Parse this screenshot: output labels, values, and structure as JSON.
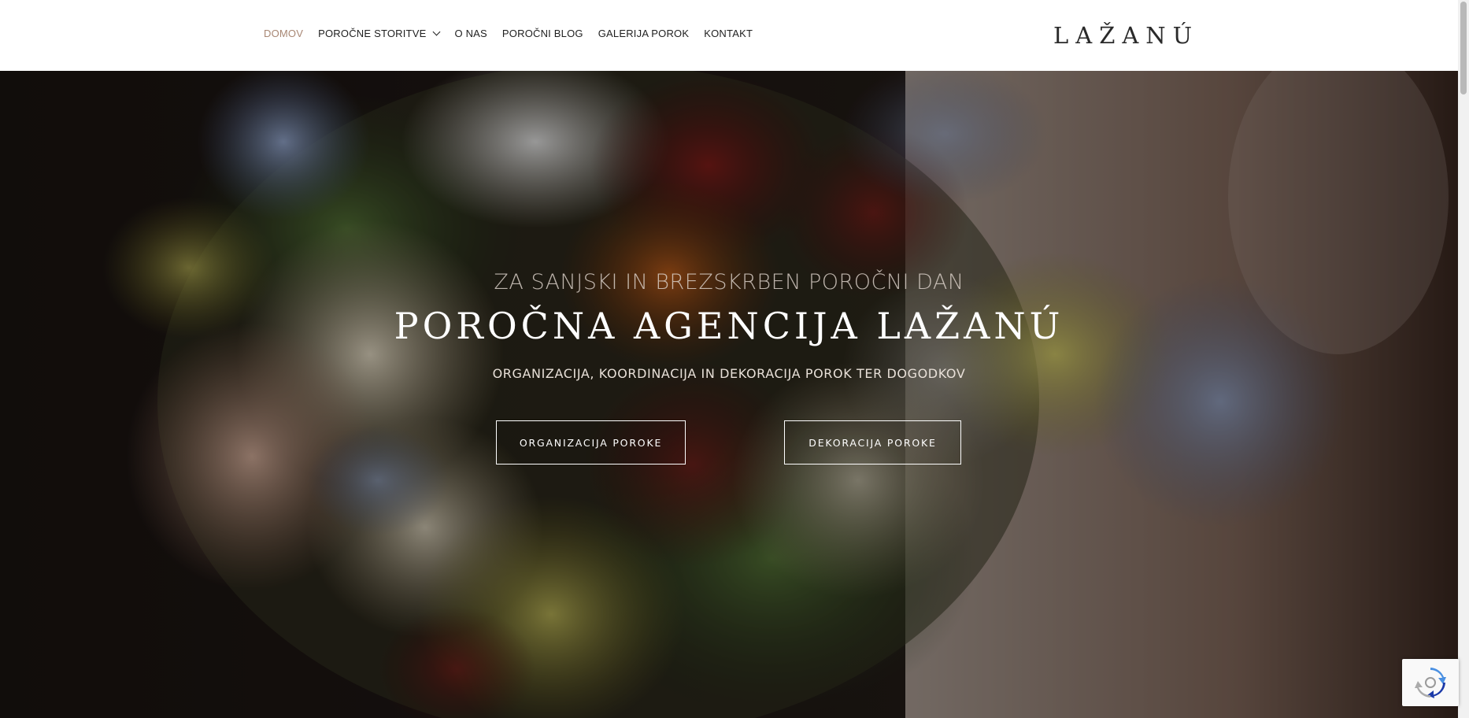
{
  "nav": {
    "items": [
      {
        "label": "DOMOV",
        "active": true,
        "has_dropdown": false
      },
      {
        "label": "POROČNE STORITVE",
        "active": false,
        "has_dropdown": true
      },
      {
        "label": "O NAS",
        "active": false,
        "has_dropdown": false
      },
      {
        "label": "POROČNI BLOG",
        "active": false,
        "has_dropdown": false
      },
      {
        "label": "GALERIJA POROK",
        "active": false,
        "has_dropdown": false
      },
      {
        "label": "KONTAKT",
        "active": false,
        "has_dropdown": false
      }
    ],
    "active_color": "#a88774"
  },
  "logo": {
    "text": "LAŽANÚ"
  },
  "hero": {
    "tagline": "ZA SANJSKI IN BREZSKRBEN POROČNI DAN",
    "title": "POROČNA AGENCIJA LAŽANÚ",
    "subtitle": "ORGANIZACIJA, KOORDINACIJA IN DEKORACIJA POROK TER DOGODKOV",
    "buttons": [
      {
        "label": "ORGANIZACIJA POROKE"
      },
      {
        "label": "DEKORACIJA POROKE"
      }
    ]
  },
  "widgets": {
    "recaptcha_icon": "recaptcha-icon"
  }
}
